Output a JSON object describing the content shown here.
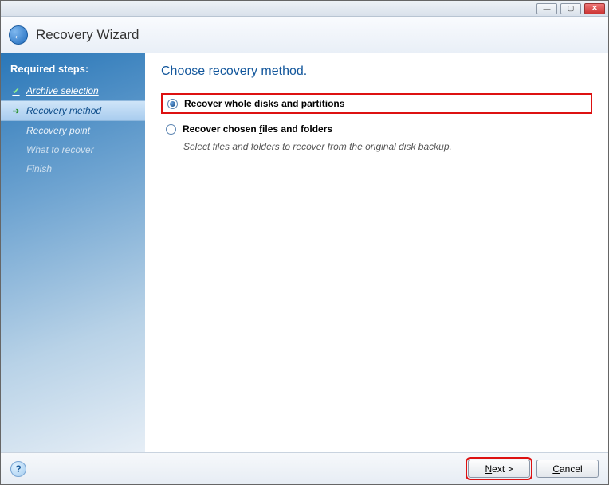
{
  "window": {
    "title": "Recovery Wizard"
  },
  "sidebar": {
    "heading": "Required steps:",
    "steps": [
      {
        "label": "Archive selection",
        "state": "completed"
      },
      {
        "label": "Recovery method",
        "state": "current"
      },
      {
        "label": "Recovery point",
        "state": "pending-underline"
      },
      {
        "label": "What to recover",
        "state": "disabled"
      },
      {
        "label": "Finish",
        "state": "disabled"
      }
    ]
  },
  "content": {
    "title": "Choose recovery method.",
    "options": [
      {
        "label_pre": "Recover whole ",
        "label_u": "d",
        "label_post": "isks and partitions",
        "selected": true,
        "highlighted": true
      },
      {
        "label_pre": "Recover chosen ",
        "label_u": "f",
        "label_post": "iles and folders",
        "selected": false,
        "highlighted": false,
        "desc": "Select files and folders to recover from the original disk backup."
      }
    ]
  },
  "footer": {
    "next_pre": "",
    "next_u": "N",
    "next_post": "ext >",
    "cancel_pre": "",
    "cancel_u": "C",
    "cancel_post": "ancel"
  }
}
